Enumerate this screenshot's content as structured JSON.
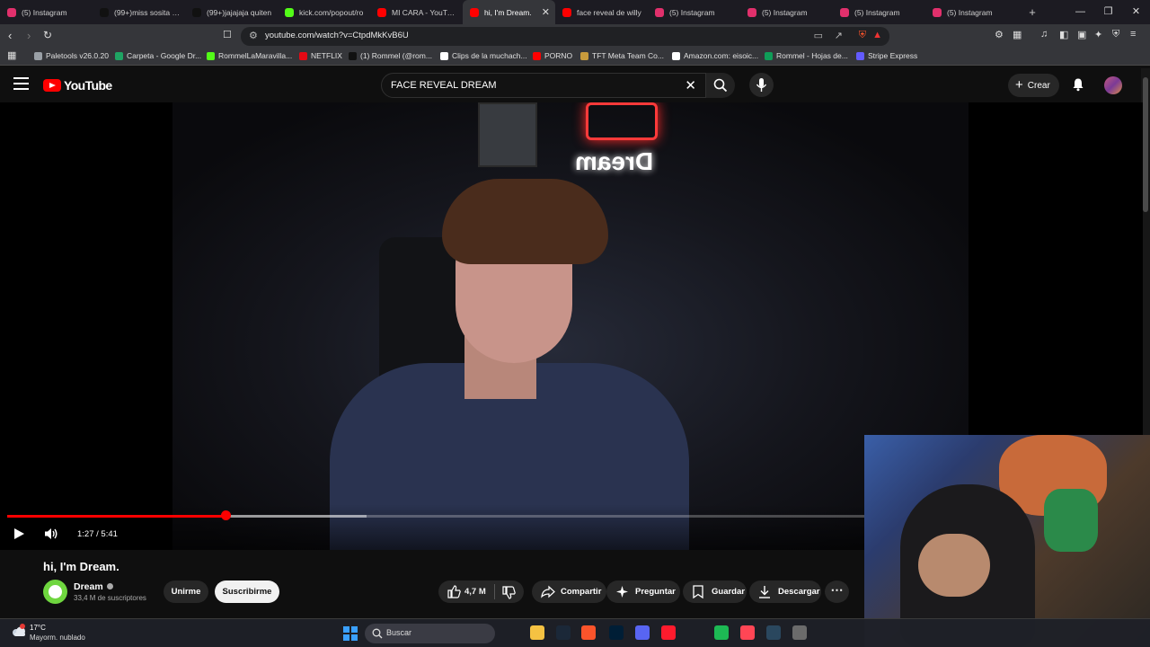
{
  "browser": {
    "tabs": [
      {
        "label": "(5) Instagram",
        "color": "#e1306c"
      },
      {
        "label": "(99+)miss sosita (@",
        "color": "#111111"
      },
      {
        "label": "(99+)jajajaja quiten",
        "color": "#111111"
      },
      {
        "label": "kick.com/popout/ro",
        "color": "#53fc18"
      },
      {
        "label": "MI CARA - YouTube",
        "color": "#ff0000"
      },
      {
        "label": "hi, I'm Dream.",
        "color": "#ff0000",
        "active": true
      },
      {
        "label": "face reveal de willy",
        "color": "#ff0000"
      },
      {
        "label": "(5) Instagram",
        "color": "#e1306c"
      },
      {
        "label": "(5) Instagram",
        "color": "#e1306c"
      },
      {
        "label": "(5) Instagram",
        "color": "#e1306c"
      },
      {
        "label": "(5) Instagram",
        "color": "#e1306c"
      }
    ],
    "url": "youtube.com/watch?v=CtpdMkKvB6U",
    "bookmarks": [
      {
        "label": "Paletools v26.0.20",
        "color": "#9aa0a6"
      },
      {
        "label": "Carpeta - Google Dr...",
        "color": "#1fa463"
      },
      {
        "label": "RommelLaMaravilla...",
        "color": "#53fc18"
      },
      {
        "label": "NETFLIX",
        "color": "#e50914"
      },
      {
        "label": "(1) Rommel (@rom...",
        "color": "#111111"
      },
      {
        "label": "Clips de la muchach...",
        "color": "#ffffff"
      },
      {
        "label": "PORNO",
        "color": "#ff0000"
      },
      {
        "label": "TFT Meta Team Co...",
        "color": "#c89b3c"
      },
      {
        "label": "Amazon.com: eisoic...",
        "color": "#ffffff"
      },
      {
        "label": "Rommel - Hojas de...",
        "color": "#0f9d58"
      },
      {
        "label": "Stripe Express",
        "color": "#635bff"
      }
    ]
  },
  "youtube": {
    "logo_text": "YouTube",
    "search_query": "FACE REVEAL DREAM",
    "create_label": "Crear",
    "video": {
      "sign_text": "Dream",
      "current_time": "1:27",
      "duration": "5:41",
      "time_display": "1:27 / 5:41",
      "progress_fraction": 0.255
    },
    "title": "hi, I'm Dream.",
    "channel": {
      "name": "Dream",
      "subscribers": "33,4 M de suscriptores"
    },
    "join_label": "Unirme",
    "subscribe_label": "Suscribirme",
    "likes": "4,7 M",
    "share_label": "Compartir",
    "ask_label": "Preguntar",
    "save_label": "Guardar",
    "download_label": "Descargar"
  },
  "taskbar": {
    "weather_temp": "17°C",
    "weather_desc": "Mayorm. nublado",
    "search_label": "Buscar",
    "apps": [
      {
        "icon": "file-explorer-icon",
        "color": "#f5c242"
      },
      {
        "icon": "steam-icon",
        "color": "#1b2838"
      },
      {
        "icon": "brave-icon",
        "color": "#fb542b"
      },
      {
        "icon": "photoshop-icon",
        "color": "#001e36"
      },
      {
        "icon": "discord-icon",
        "color": "#5865f2"
      },
      {
        "icon": "opera-icon",
        "color": "#ff1b2d"
      },
      {
        "icon": "spotify-icon",
        "color": "#1db954"
      },
      {
        "icon": "valorant-icon",
        "color": "#ff4655"
      },
      {
        "icon": "steam-icon",
        "color": "#2a475e"
      },
      {
        "icon": "settings-icon",
        "color": "#6b6b6b"
      }
    ]
  },
  "colors": {
    "accent": "#ff0000",
    "background": "#0f0f0f"
  }
}
